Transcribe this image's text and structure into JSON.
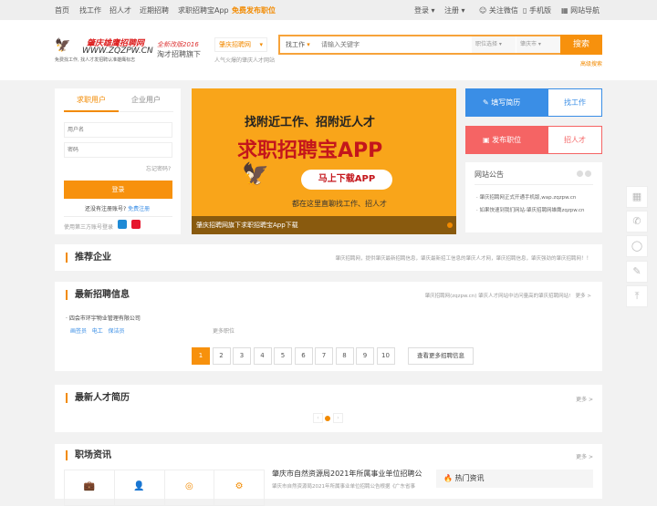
{
  "topbar": {
    "nav": [
      "首页",
      "找工作",
      "招人才",
      "近期招聘",
      "求职招聘宝App",
      "免费发布职位"
    ],
    "login": "登录",
    "register": "注册",
    "wechat": "关注微信",
    "mobile": "手机版",
    "sitenav": "网站导航"
  },
  "header": {
    "logo_title": "肇庆雄鹰招聘网",
    "logo_url": "WWW.ZQZPW.CN",
    "logo_slogan": "免费找工作, 找人才发招聘认准雄鹰标志",
    "revision": "全新改版2016",
    "revision_sub": "淘才招聘旗下",
    "site_select": "肇庆招聘网",
    "site_sub": "人气火爆的肇庆人才网站",
    "search_type": "找工作",
    "search_placeholder": "请输入关键字",
    "job_select": "职位选择",
    "city_select": "肇庆市",
    "search_btn": "搜索",
    "advanced": "高级搜索"
  },
  "login": {
    "tabs": [
      "求职用户",
      "企业用户"
    ],
    "username_placeholder": "用户名",
    "password_placeholder": "密码",
    "forgot": "忘记密码?",
    "submit": "登录",
    "no_account": "还没有注册账号?",
    "free_register": "免费注册",
    "third_party": "使用第三方账号登录"
  },
  "banner": {
    "line1": "找附近工作、招附近人才",
    "line2": "求职招聘宝APP",
    "download": "马上下载APP",
    "line3": "都在这里直聊找工作、招人才",
    "caption": "肇庆招聘网旗下求职招聘宝App下载"
  },
  "actions": {
    "resume": "填写简历",
    "find_job": "找工作",
    "post_job": "发布职位",
    "find_talent": "招人才",
    "colors": {
      "blue": "#3a8ee6",
      "red": "#f56464"
    }
  },
  "notice": {
    "title": "网站公告",
    "items": [
      "肇庆招聘网正式开通手机版,wap.zqzpw.cn",
      "如果快速到我们网站-肇庆招聘网雄鹰zqzpw.cn"
    ]
  },
  "recommend": {
    "title": "推荐企业",
    "desc": "肇庆招聘网，提供肇庆最新招聘信息，肇庆最新招工信息的肇庆人才网，肇庆招聘信息，肇庆强劲的肇庆招聘网！！"
  },
  "latest_jobs": {
    "title": "最新招聘信息",
    "desc": "肇庆招聘网(zqzpw.cn) 肇庆人才网站中访问量高的肇庆招聘网站!",
    "more": "更多 >",
    "company": "四会市环宇物业管理有限公司",
    "jobs": [
      "画签员",
      "电工",
      "保洁员"
    ],
    "more_jobs": "更多职位",
    "pages": [
      "1",
      "2",
      "3",
      "4",
      "5",
      "6",
      "7",
      "8",
      "9",
      "10"
    ],
    "view_more": "查看更多招聘信息"
  },
  "resumes": {
    "title": "最新人才简历",
    "more": "更多 >"
  },
  "news": {
    "title": "职场资讯",
    "more": "更多 >",
    "headline": "肇庆市自然资源局2021年所属事业单位招聘公",
    "summary": "肇庆市自然资源局2021年所属事业单位招聘公告根据《广东省事",
    "hot": "热门资讯"
  },
  "accent": "#f28a00"
}
